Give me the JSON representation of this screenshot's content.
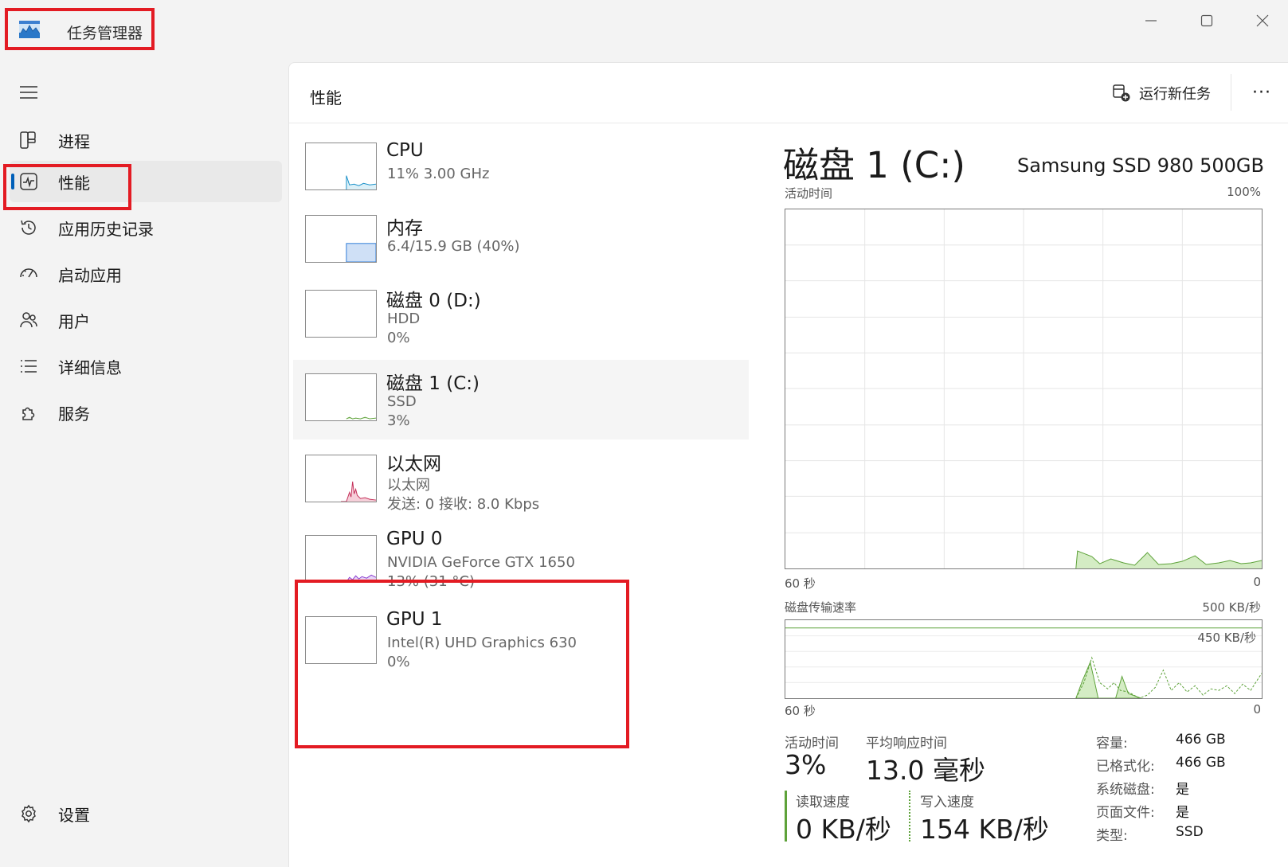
{
  "window": {
    "title": "任务管理器"
  },
  "sidebar": {
    "items": [
      {
        "label": "进程"
      },
      {
        "label": "性能"
      },
      {
        "label": "应用历史记录"
      },
      {
        "label": "启动应用"
      },
      {
        "label": "用户"
      },
      {
        "label": "详细信息"
      },
      {
        "label": "服务"
      }
    ],
    "settings": "设置",
    "active_index": 1
  },
  "header": {
    "title": "性能",
    "run_new_task": "运行新任务",
    "more": "···"
  },
  "devices": [
    {
      "name": "CPU",
      "line1": "11%  3.00 GHz",
      "line2": "",
      "color": "#1a91c9"
    },
    {
      "name": "内存",
      "line1": "6.4/15.9 GB (40%)",
      "line2": "",
      "color": "#2f7cd8"
    },
    {
      "name": "磁盘 0 (D:)",
      "line1": "HDD",
      "line2": "0%",
      "color": "#5ea23a"
    },
    {
      "name": "磁盘 1 (C:)",
      "line1": "SSD",
      "line2": "3%",
      "color": "#5ea23a"
    },
    {
      "name": "以太网",
      "line1": "以太网",
      "line2": "发送: 0 接收: 8.0 Kbps",
      "color": "#c4305a"
    },
    {
      "name": "GPU 0",
      "line1": "NVIDIA GeForce GTX 1650",
      "line2": "13%  (31 °C)",
      "color": "#8b3fd0"
    },
    {
      "name": "GPU 1",
      "line1": "Intel(R) UHD Graphics 630",
      "line2": "0%",
      "color": "#8b3fd0"
    }
  ],
  "detail": {
    "title": "磁盘 1 (C:)",
    "model": "Samsung SSD 980 500GB",
    "chart1": {
      "label": "活动时间",
      "max": "100%",
      "time_left": "60 秒",
      "time_right": "0"
    },
    "chart2": {
      "label": "磁盘传输速率",
      "max": "500 KB/秒",
      "inner_max": "450 KB/秒",
      "time_left": "60 秒",
      "time_right": "0"
    },
    "stats": {
      "active_label": "活动时间",
      "active_value": "3%",
      "resp_label": "平均响应时间",
      "resp_value": "13.0 毫秒",
      "read_label": "读取速度",
      "read_value": "0 KB/秒",
      "write_label": "写入速度",
      "write_value": "154 KB/秒"
    },
    "props": [
      {
        "k": "容量:",
        "v": "466 GB"
      },
      {
        "k": "已格式化:",
        "v": "466 GB"
      },
      {
        "k": "系统磁盘:",
        "v": "是"
      },
      {
        "k": "页面文件:",
        "v": "是"
      },
      {
        "k": "类型:",
        "v": "SSD"
      }
    ]
  }
}
